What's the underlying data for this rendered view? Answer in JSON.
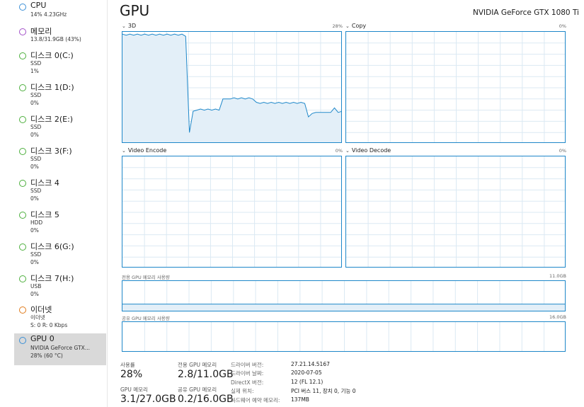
{
  "sidebar": {
    "items": [
      {
        "name": "CPU",
        "sub1": "14%  4.23GHz",
        "sub2": "",
        "color": "#3a8fd6"
      },
      {
        "name": "메모리",
        "sub1": "13.8/31.9GB (43%)",
        "sub2": "",
        "color": "#a24fc8"
      },
      {
        "name": "디스크 0(C:)",
        "sub1": "SSD",
        "sub2": "1%",
        "color": "#4caf3c"
      },
      {
        "name": "디스크 1(D:)",
        "sub1": "SSD",
        "sub2": "0%",
        "color": "#4caf3c"
      },
      {
        "name": "디스크 2(E:)",
        "sub1": "SSD",
        "sub2": "0%",
        "color": "#4caf3c"
      },
      {
        "name": "디스크 3(F:)",
        "sub1": "SSD",
        "sub2": "0%",
        "color": "#4caf3c"
      },
      {
        "name": "디스크 4",
        "sub1": "SSD",
        "sub2": "0%",
        "color": "#4caf3c"
      },
      {
        "name": "디스크 5",
        "sub1": "HDD",
        "sub2": "0%",
        "color": "#4caf3c"
      },
      {
        "name": "디스크 6(G:)",
        "sub1": "SSD",
        "sub2": "0%",
        "color": "#4caf3c"
      },
      {
        "name": "디스크 7(H:)",
        "sub1": "USB",
        "sub2": "0%",
        "color": "#4caf3c"
      },
      {
        "name": "이더넷",
        "sub1": "이더넷",
        "sub2": "S: 0  R: 0 Kbps",
        "color": "#e07a1a"
      },
      {
        "name": "GPU 0",
        "sub1": "NVIDIA GeForce GTX...",
        "sub2": "28%  (60 °C)",
        "color": "#3a8fd6",
        "selected": true
      }
    ]
  },
  "header": {
    "title": "GPU",
    "adapter": "NVIDIA GeForce GTX 1080 Ti"
  },
  "graphs": {
    "g3d": {
      "label": "3D",
      "pct": "28%"
    },
    "copy": {
      "label": "Copy",
      "pct": "0%"
    },
    "video_encode": {
      "label": "Video Encode",
      "pct": "0%"
    },
    "video_decode": {
      "label": "Video Decode",
      "pct": "0%"
    },
    "dedicated_mem": {
      "label": "전용 GPU 메모리 사용량",
      "max": "11.0GB"
    },
    "shared_mem": {
      "label": "공유 GPU 메모리 사용량",
      "max": "16.0GB"
    }
  },
  "chart_data": {
    "type": "area",
    "title": "3D",
    "ylim": [
      0,
      100
    ],
    "x": [
      0,
      1,
      2,
      3,
      4,
      5,
      6,
      7,
      8,
      9,
      10,
      11,
      12,
      13,
      14,
      15,
      16,
      17,
      18,
      19,
      20,
      21,
      22,
      23,
      24,
      25,
      26,
      27,
      28,
      29,
      30,
      31,
      32,
      33,
      34,
      35,
      36,
      37,
      38,
      39,
      40,
      41,
      42,
      43,
      44,
      45,
      46,
      47,
      48,
      49,
      50,
      51,
      52,
      53,
      54,
      55,
      56,
      57,
      58,
      59
    ],
    "series": [
      {
        "values": [
          98,
          97,
          98,
          97,
          98,
          97,
          98,
          97,
          98,
          97,
          98,
          97,
          98,
          97,
          98,
          97,
          98,
          96,
          10,
          29,
          30,
          31,
          30,
          31,
          30,
          31,
          30,
          40,
          40,
          40,
          41,
          40,
          41,
          40,
          41,
          40,
          37,
          36,
          37,
          36,
          37,
          36,
          37,
          36,
          37,
          36,
          37,
          36,
          37,
          36,
          24,
          27,
          28,
          28,
          28,
          28,
          28,
          32,
          28,
          29
        ]
      }
    ],
    "dedicated_mem_fraction": 0.26,
    "shared_mem_fraction": 0.0125
  },
  "stats": {
    "util_label": "사용률",
    "util_value": "28%",
    "ded_label": "전용 GPU 메모리",
    "ded_value": "2.8/11.0GB",
    "gpumem_label": "GPU 메모리",
    "gpumem_value": "3.1/27.0GB",
    "shared_label": "공유 GPU 메모리",
    "shared_value": "0.2/16.0GB"
  },
  "details": [
    {
      "label": "드라이버 버전:",
      "value": "27.21.14.5167"
    },
    {
      "label": "드라이버 날짜:",
      "value": "2020-07-05"
    },
    {
      "label": "DirectX 버전:",
      "value": "12 (FL 12.1)"
    },
    {
      "label": "실제 위치:",
      "value": "PCI 버스 11, 장치 0, 기능 0"
    },
    {
      "label": "하드웨어 예약 메모리:",
      "value": "137MB"
    }
  ],
  "colors": {
    "accent": "#1e87c9",
    "fill": "#e3eff8",
    "grid": "#dbe9f3",
    "selected_bg": "#d9d9d9"
  }
}
